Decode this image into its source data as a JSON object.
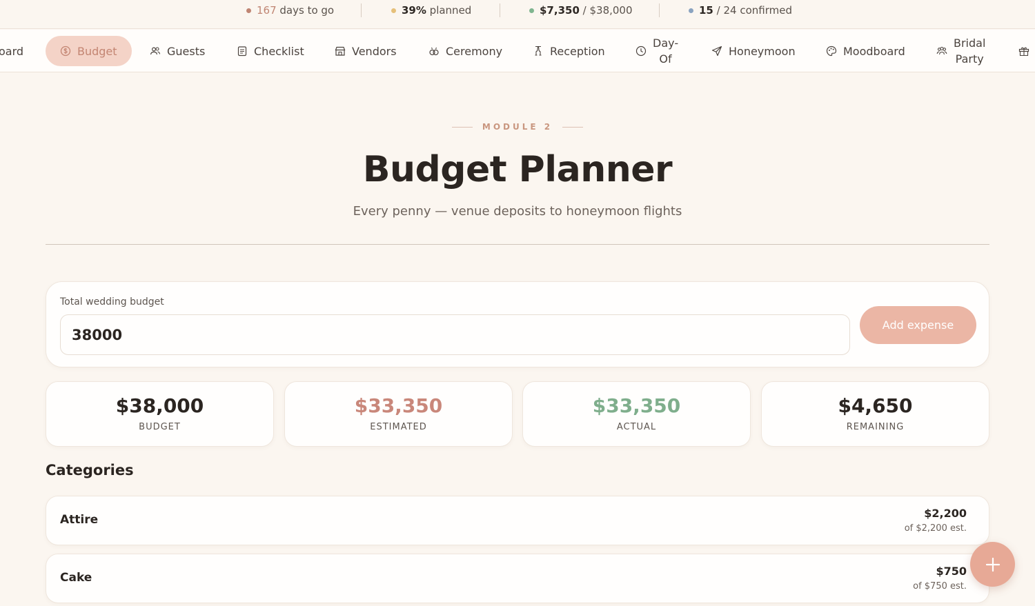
{
  "status": {
    "days_count": "167",
    "days_label": " days to go",
    "planned_pct": "39%",
    "planned_label": " planned",
    "spent": "$7,350",
    "spent_total": " / $38,000",
    "confirmed": "15",
    "confirmed_total": " / 24 confirmed",
    "colors": {
      "days": "#c08573",
      "planned": "#e6c07a",
      "spent": "#7fb58f",
      "confirmed": "#8aa3c0"
    }
  },
  "nav": {
    "items": [
      {
        "label": "oard",
        "icon": "dashboard-icon"
      },
      {
        "label": "Budget",
        "icon": "dollar-circle-icon",
        "active": true
      },
      {
        "label": "Guests",
        "icon": "users-icon"
      },
      {
        "label": "Checklist",
        "icon": "clipboard-icon"
      },
      {
        "label": "Vendors",
        "icon": "storefront-icon"
      },
      {
        "label": "Ceremony",
        "icon": "rings-icon"
      },
      {
        "label": "Reception",
        "icon": "glasses-icon"
      },
      {
        "label_line1": "Day-",
        "label_line2": "Of",
        "icon": "clock-icon"
      },
      {
        "label": "Honeymoon",
        "icon": "send-icon"
      },
      {
        "label": "Moodboard",
        "icon": "palette-icon"
      },
      {
        "label_line1": "Bridal",
        "label_line2": "Party",
        "icon": "group-icon"
      },
      {
        "label": "",
        "icon": "gift-icon"
      }
    ]
  },
  "header": {
    "eyebrow": "MODULE 2",
    "title": "Budget Planner",
    "subtitle": "Every penny — venue deposits to honeymoon flights"
  },
  "budget": {
    "label": "Total wedding budget",
    "value": "38000",
    "add_button": "Add expense"
  },
  "stats": [
    {
      "value": "$38,000",
      "caption": "BUDGET",
      "color": "#2b2521"
    },
    {
      "value": "$33,350",
      "caption": "ESTIMATED",
      "color": "#c9877a"
    },
    {
      "value": "$33,350",
      "caption": "ACTUAL",
      "color": "#7fae8c"
    },
    {
      "value": "$4,650",
      "caption": "REMAINING",
      "color": "#2b2521"
    }
  ],
  "categories": {
    "heading": "Categories",
    "rows": [
      {
        "name": "Attire",
        "amount": "$2,200",
        "estimate": "of $2,200 est."
      },
      {
        "name": "Cake",
        "amount": "$750",
        "estimate": "of $750 est."
      }
    ]
  },
  "accent": "#e7a996",
  "fab_icon": "plus-icon"
}
